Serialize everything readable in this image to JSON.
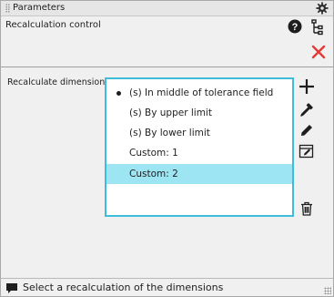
{
  "window": {
    "title": "Parameters"
  },
  "top": {
    "recalc_control_label": "Recalculation control"
  },
  "main": {
    "recalc_label": "Recalculate dimensions:",
    "options": [
      {
        "label": "(s) In middle of tolerance field",
        "bullet": true,
        "selected": false
      },
      {
        "label": "(s) By upper limit",
        "bullet": false,
        "selected": false
      },
      {
        "label": "(s) By lower limit",
        "bullet": false,
        "selected": false
      },
      {
        "label": "Custom: 1",
        "bullet": false,
        "selected": false
      },
      {
        "label": "Custom: 2",
        "bullet": false,
        "selected": true
      }
    ]
  },
  "status": {
    "text": "Select a recalculation of the dimensions"
  },
  "colors": {
    "accent_border": "#3fbcd9",
    "selection": "#9ee5f4",
    "close_red": "#e53935"
  },
  "icons": [
    "gear-icon",
    "help-icon",
    "tree-icon",
    "close-icon",
    "add-icon",
    "eyedropper-icon",
    "pencil-icon",
    "edit-table-icon",
    "trash-icon",
    "comment-icon"
  ]
}
